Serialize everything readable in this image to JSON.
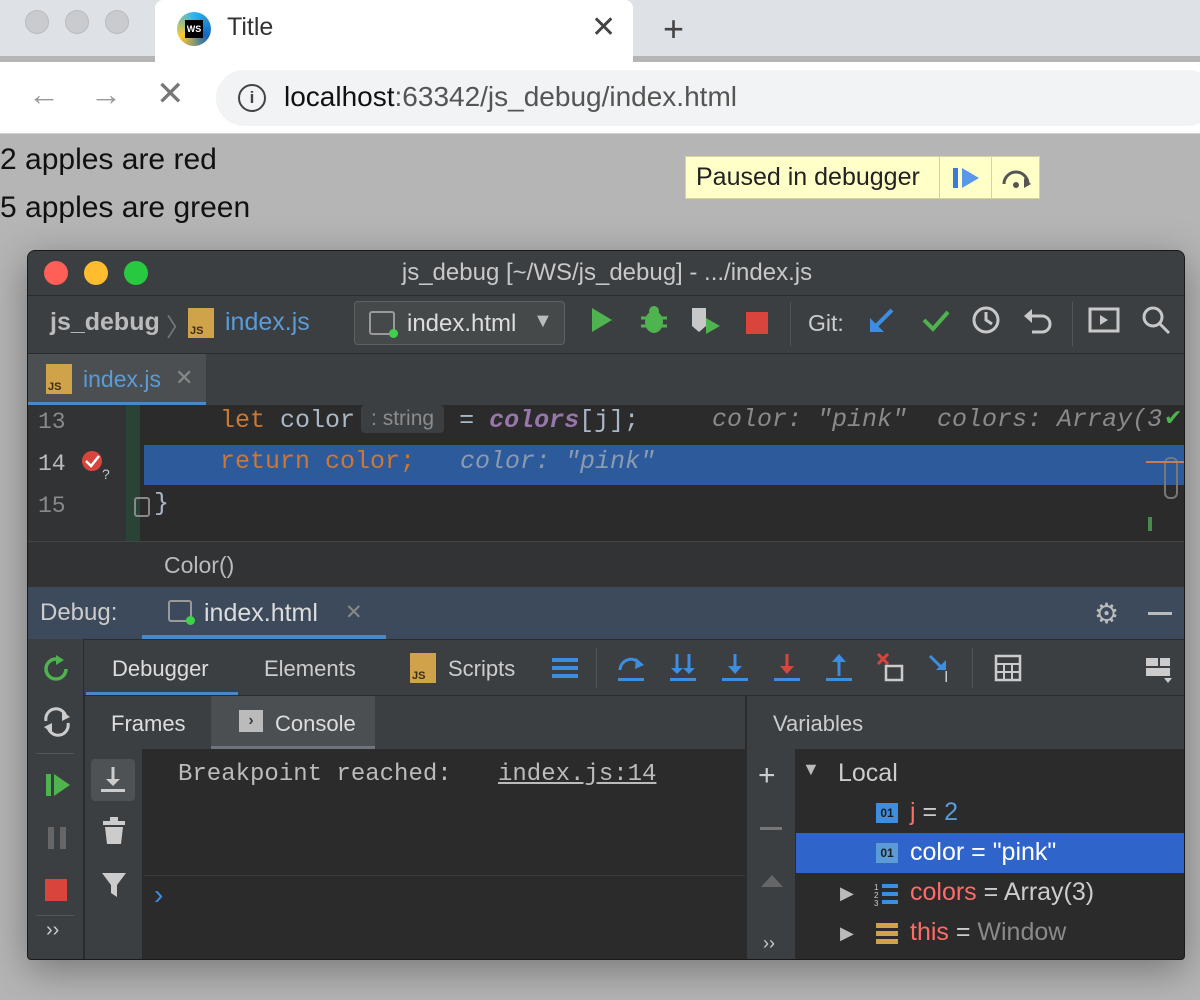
{
  "browser": {
    "tab_title": "Title",
    "url_host": "localhost",
    "url_rest": ":63342/js_debug/index.html"
  },
  "page": {
    "line1": "2 apples are red",
    "line2": "5 apples are green",
    "paused_label": "Paused in debugger"
  },
  "ide": {
    "window_title": "js_debug [~/WS/js_debug] - .../index.js",
    "project": "js_debug",
    "file": "index.js",
    "run_config": "index.html",
    "git_label": "Git:",
    "editor_tab": "index.js",
    "lines": [
      {
        "num": "13",
        "kw": "let",
        "var": " color",
        "hint": ": string",
        "rest_a": " = ",
        "ident": "colors",
        "rest_b": "[j];",
        "inline": "color: \"pink\"  colors: Array(3"
      },
      {
        "num": "14",
        "kw": "return",
        "var": " color;",
        "inline": "color: \"pink\""
      },
      {
        "num": "15",
        "brace": "}"
      }
    ],
    "breadcrumb": "Color()",
    "debug_label": "Debug:",
    "debug_tab": "index.html",
    "subtabs": [
      "Debugger",
      "Elements",
      "Scripts"
    ],
    "console_tabs": [
      "Frames",
      "Console"
    ],
    "variables_label": "Variables",
    "console_msg": "Breakpoint reached:",
    "console_link": "index.js:14",
    "console_prompt": "›",
    "vars": {
      "local": "Local",
      "j_name": "j",
      "j_val": "2",
      "color_name": "color",
      "color_val": "\"pink\"",
      "colors_name": "colors",
      "colors_val": "Array(3)",
      "this_name": "this",
      "this_val": "Window"
    }
  },
  "colors": {
    "keyword": "#cc7832",
    "highlight": "#2d5a9b",
    "selected": "#2f65ca",
    "var_red": "#ff6b68"
  }
}
